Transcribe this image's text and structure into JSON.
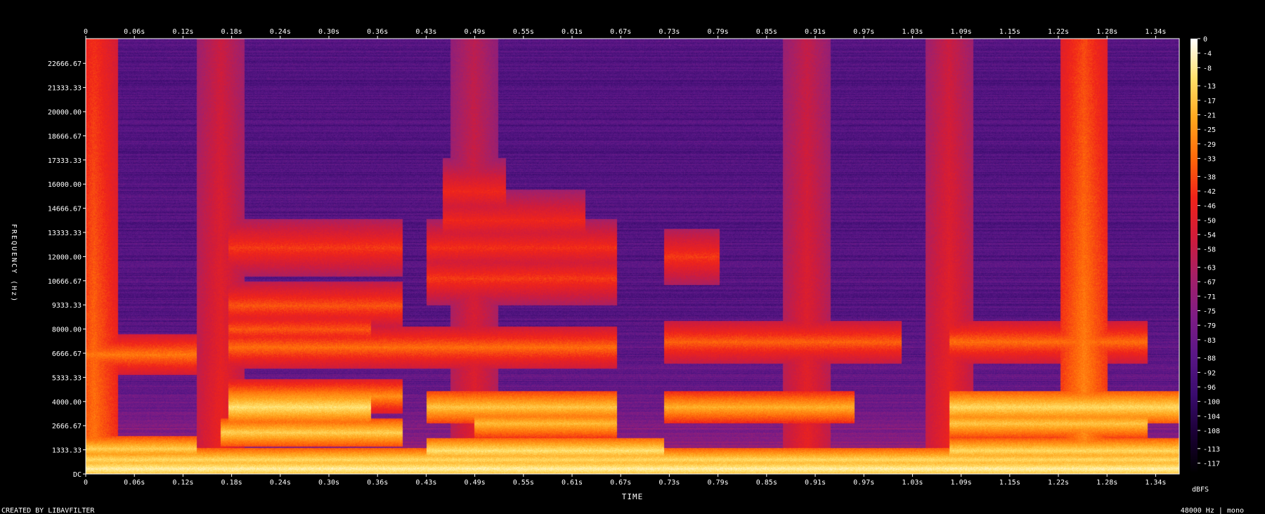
{
  "chart_data": {
    "type": "heatmap",
    "subtype": "spectrogram",
    "xlabel": "TIME",
    "ylabel": "FREQUENCY (Hz)",
    "x_ticks": [
      "0",
      "0.06s",
      "0.12s",
      "0.18s",
      "0.24s",
      "0.30s",
      "0.36s",
      "0.43s",
      "0.49s",
      "0.55s",
      "0.61s",
      "0.67s",
      "0.73s",
      "0.79s",
      "0.85s",
      "0.91s",
      "0.97s",
      "1.03s",
      "1.09s",
      "1.15s",
      "1.22s",
      "1.28s",
      "1.34s"
    ],
    "y_ticks": [
      "22666.67",
      "21333.33",
      "20000.00",
      "18666.67",
      "17333.33",
      "16000.00",
      "14666.67",
      "13333.33",
      "12000.00",
      "10666.67",
      "9333.33",
      "8000.00",
      "6666.67",
      "5333.33",
      "4000.00",
      "2666.67",
      "1333.33",
      "DC"
    ],
    "colorbar_ticks": [
      "0",
      "-4",
      "-8",
      "-13",
      "-17",
      "-21",
      "-25",
      "-29",
      "-33",
      "-38",
      "-42",
      "-46",
      "-50",
      "-54",
      "-58",
      "-63",
      "-67",
      "-71",
      "-75",
      "-79",
      "-83",
      "-88",
      "-92",
      "-96",
      "-100",
      "-104",
      "-108",
      "-113",
      "-117"
    ],
    "colorbar_label": "dBFS",
    "colormap": [
      "#000000",
      "#1a0033",
      "#3a0c6e",
      "#5a1787",
      "#7f1d85",
      "#a52068",
      "#d11c3a",
      "#f0241a",
      "#ff6a0a",
      "#ffa81f",
      "#ffe06a",
      "#ffffff"
    ],
    "bands": [
      {
        "f": 300,
        "t": [
          0,
          1.4
        ],
        "db": -6
      },
      {
        "f": 800,
        "t": [
          0,
          1.4
        ],
        "db": -12
      },
      {
        "f": 1400,
        "t": [
          0,
          0.14
        ],
        "db": -14
      },
      {
        "f": 1300,
        "t": [
          0.43,
          0.73
        ],
        "db": -10
      },
      {
        "f": 1300,
        "t": [
          1.09,
          1.4
        ],
        "db": -12
      },
      {
        "f": 2300,
        "t": [
          0.17,
          0.4
        ],
        "db": -14
      },
      {
        "f": 2800,
        "t": [
          0.49,
          0.67
        ],
        "db": -18
      },
      {
        "f": 2800,
        "t": [
          1.09,
          1.34
        ],
        "db": -16
      },
      {
        "f": 3700,
        "t": [
          0.18,
          0.36
        ],
        "db": -10
      },
      {
        "f": 3700,
        "t": [
          0.43,
          0.67
        ],
        "db": -16
      },
      {
        "f": 3700,
        "t": [
          0.73,
          0.97
        ],
        "db": -20
      },
      {
        "f": 3700,
        "t": [
          1.09,
          1.4
        ],
        "db": -12
      },
      {
        "f": 4300,
        "t": [
          0.18,
          0.4
        ],
        "db": -26
      },
      {
        "f": 6600,
        "t": [
          0,
          0.14
        ],
        "db": -30
      },
      {
        "f": 7000,
        "t": [
          0.18,
          0.67
        ],
        "db": -32
      },
      {
        "f": 7300,
        "t": [
          0.73,
          1.03
        ],
        "db": -34
      },
      {
        "f": 7300,
        "t": [
          1.09,
          1.34
        ],
        "db": -32
      },
      {
        "f": 8000,
        "t": [
          0.18,
          0.36
        ],
        "db": -36
      },
      {
        "f": 9300,
        "t": [
          0.18,
          0.4
        ],
        "db": -36
      },
      {
        "f": 10800,
        "t": [
          0.43,
          0.67
        ],
        "db": -40
      },
      {
        "f": 12500,
        "t": [
          0.18,
          0.4
        ],
        "db": -40
      },
      {
        "f": 12500,
        "t": [
          0.43,
          0.67
        ],
        "db": -42
      },
      {
        "f": 12000,
        "t": [
          0.73,
          0.8
        ],
        "db": -40
      },
      {
        "f": 14000,
        "t": [
          0.45,
          0.63
        ],
        "db": -44
      },
      {
        "f": 15600,
        "t": [
          0.45,
          0.53
        ],
        "db": -44
      }
    ],
    "onsets": [
      {
        "t": 0.01,
        "db": -30,
        "fmax": 24000
      },
      {
        "t": 0.17,
        "db": -44,
        "fmax": 24000
      },
      {
        "t": 0.49,
        "db": -48,
        "fmax": 24000
      },
      {
        "t": 0.91,
        "db": -46,
        "fmax": 24000
      },
      {
        "t": 1.09,
        "db": -44,
        "fmax": 24000
      },
      {
        "t": 1.26,
        "db": -26,
        "fmax": 24000
      }
    ],
    "noise_floor_db": -90
  },
  "footer": {
    "created_by": "CREATED BY LIBAVFILTER",
    "stream_info": "48000 Hz | mono"
  }
}
